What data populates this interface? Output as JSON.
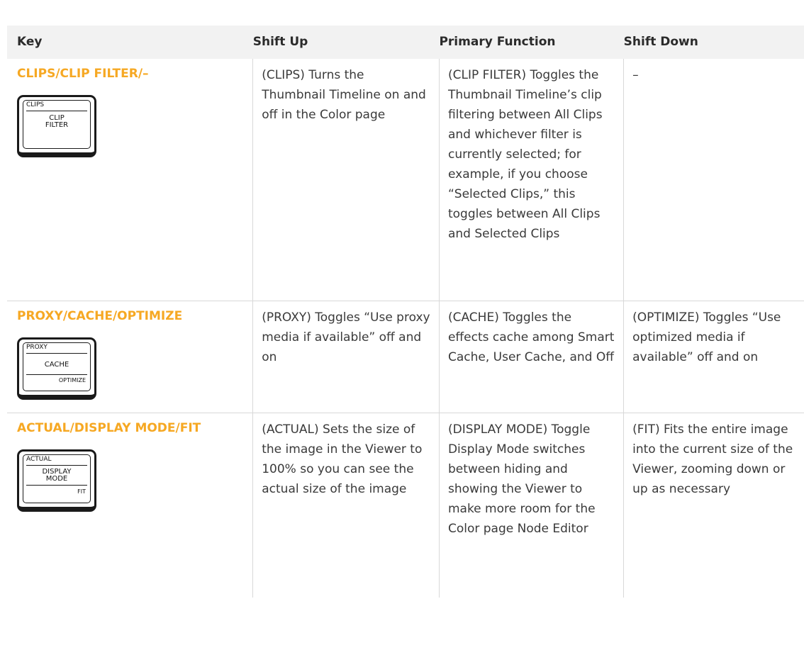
{
  "header": {
    "key": "Key",
    "shift_up": "Shift Up",
    "primary": "Primary Function",
    "shift_down": "Shift Down"
  },
  "rows": [
    {
      "key_name": "CLIPS/CLIP FILTER/–",
      "keycap": {
        "top": "CLIPS",
        "middle_line1": "CLIP",
        "middle_line2": "FILTER",
        "bottom": ""
      },
      "shift_up": "(CLIPS) Turns the Thumbnail Timeline on and off in the Color page",
      "primary": "(CLIP FILTER) Toggles the Thumbnail Timeline’s clip filtering between All Clips and whichever filter is currently selected; for example, if you choose “Selected Clips,” this toggles between All Clips and Selected Clips",
      "shift_down": "–"
    },
    {
      "key_name": "PROXY/CACHE/OPTIMIZE",
      "keycap": {
        "top": "PROXY",
        "middle_line1": "CACHE",
        "middle_line2": "",
        "bottom": "OPTIMIZE"
      },
      "shift_up": "(PROXY) Toggles “Use proxy media if available” off and on",
      "primary": "(CACHE) Toggles the effects cache among Smart Cache, User Cache, and Off",
      "shift_down": "(OPTIMIZE) Toggles “Use optimized media if available” off and on"
    },
    {
      "key_name": "ACTUAL/DISPLAY MODE/FIT",
      "keycap": {
        "top": "ACTUAL",
        "middle_line1": "DISPLAY",
        "middle_line2": "MODE",
        "bottom": "FIT"
      },
      "shift_up": "(ACTUAL) Sets the size of the image in the Viewer to 100% so you can see the actual size of the image",
      "primary": "(DISPLAY MODE) Toggle Display Mode switches between hiding and showing the Viewer to make more room for the Color page Node Editor",
      "shift_down": "(FIT) Fits the entire image into the current size of the Viewer, zooming down or up as necessary"
    }
  ],
  "colors": {
    "key_name": "#f6a823",
    "header_bg": "#f2f2f2",
    "divider": "#d8d8d8"
  }
}
